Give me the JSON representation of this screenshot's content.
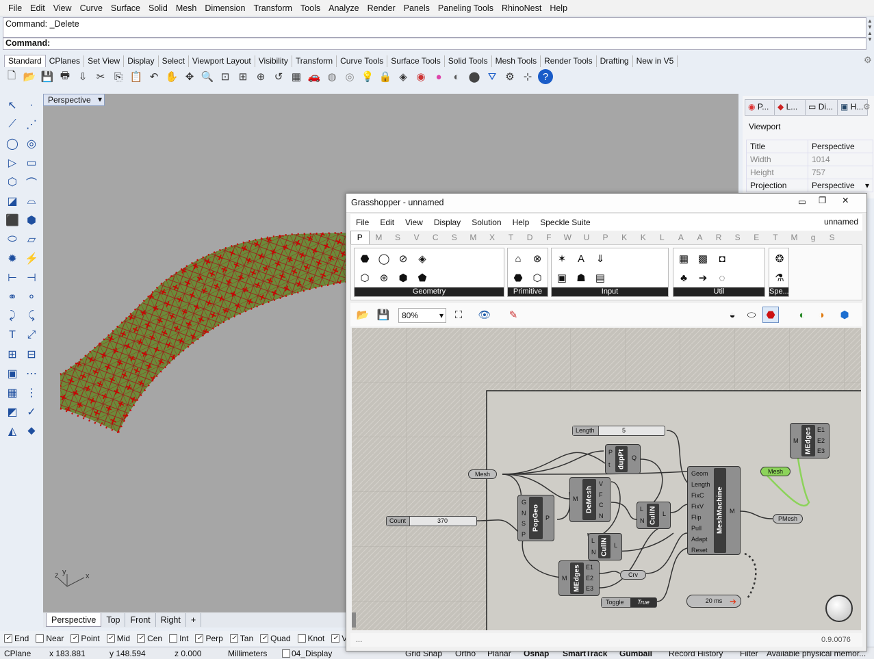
{
  "menubar": {
    "items": [
      "File",
      "Edit",
      "View",
      "Curve",
      "Surface",
      "Solid",
      "Mesh",
      "Dimension",
      "Transform",
      "Tools",
      "Analyze",
      "Render",
      "Panels",
      "Paneling Tools",
      "RhinoNest",
      "Help"
    ]
  },
  "command": {
    "history": "Command: _Delete",
    "prompt": "Command:"
  },
  "toolbar_tabs": [
    "Standard",
    "CPlanes",
    "Set View",
    "Display",
    "Select",
    "Viewport Layout",
    "Visibility",
    "Transform",
    "Curve Tools",
    "Surface Tools",
    "Solid Tools",
    "Mesh Tools",
    "Render Tools",
    "Drafting",
    "New in V5"
  ],
  "toolbar_icons": [
    "new-icon",
    "open-icon",
    "save-icon",
    "print-icon",
    "import-icon",
    "cut-icon",
    "copy-icon",
    "paste-icon",
    "undo-icon",
    "pan-icon",
    "rotate-view-icon",
    "zoom-icon",
    "zoom-window-icon",
    "zoom-extents-icon",
    "zoom-selected-icon",
    "undo-view-icon",
    "four-viewports-icon",
    "car-icon",
    "shade-icon",
    "render-preview-icon",
    "lightbulb-icon",
    "lock-icon",
    "layer-icon",
    "color-wheel-icon",
    "material-ball-icon",
    "environment-icon",
    "render-icon",
    "filter-icon",
    "options-gear-icon",
    "grid-snap-icon",
    "help-icon"
  ],
  "viewport": {
    "title": "Perspective",
    "axes": {
      "z": "z",
      "y": "y",
      "x": "x"
    }
  },
  "viewport_tabs": [
    "Perspective",
    "Top",
    "Front",
    "Right",
    "+"
  ],
  "osnaps": [
    {
      "label": "End",
      "checked": true
    },
    {
      "label": "Near",
      "checked": false
    },
    {
      "label": "Point",
      "checked": true
    },
    {
      "label": "Mid",
      "checked": true
    },
    {
      "label": "Cen",
      "checked": true
    },
    {
      "label": "Int",
      "checked": false
    },
    {
      "label": "Perp",
      "checked": true
    },
    {
      "label": "Tan",
      "checked": true
    },
    {
      "label": "Quad",
      "checked": true
    },
    {
      "label": "Knot",
      "checked": false
    },
    {
      "label": "Verte",
      "checked": true
    }
  ],
  "status": {
    "cplane": "CPlane",
    "x": "x 183.881",
    "y": "y 148.594",
    "z": "z 0.000",
    "units": "Millimeters",
    "layer": "04_Display",
    "buttons": [
      "Grid Snap",
      "Ortho",
      "Planar",
      "Osnap",
      "SmartTrack",
      "Gumball",
      "Record History",
      "Filter",
      "Available physical memor..."
    ]
  },
  "properties": {
    "tabs": [
      "P...",
      "L...",
      "Di...",
      "H..."
    ],
    "section": "Viewport",
    "rows": [
      {
        "key": "Title",
        "value": "Perspective"
      },
      {
        "key": "Width",
        "value": "1014"
      },
      {
        "key": "Height",
        "value": "757"
      },
      {
        "key": "Projection",
        "value": "Perspective"
      }
    ]
  },
  "grasshopper": {
    "title": "Grasshopper - unnamed",
    "doc_name": "unnamed",
    "menu": [
      "File",
      "Edit",
      "View",
      "Display",
      "Solution",
      "Help",
      "Speckle Suite"
    ],
    "tabs": [
      "P",
      "M",
      "S",
      "V",
      "C",
      "S",
      "M",
      "X",
      "T",
      "D",
      "F",
      "W",
      "U",
      "P",
      "K",
      "K",
      "L",
      "A",
      "A",
      "R",
      "S",
      "E",
      "T",
      "M",
      "g",
      "S"
    ],
    "ribbon_groups": [
      "Geometry",
      "Primitive",
      "Input",
      "Util",
      "Spe..."
    ],
    "zoom": "80%",
    "version": "0.9.0076",
    "nodes": {
      "length_label": "Length",
      "length_value": "5",
      "count_label": "Count",
      "count_value": "370",
      "mesh_param": "Mesh",
      "duppt": {
        "name": "dupPt",
        "inputs": [
          "P",
          "t"
        ],
        "outputs": [
          "Q"
        ]
      },
      "demesh": {
        "name": "DeMesh",
        "inputs": [
          "M"
        ],
        "outputs": [
          "V",
          "F",
          "C",
          "N"
        ]
      },
      "popgeo": {
        "name": "PopGeo",
        "inputs": [
          "G",
          "N",
          "S",
          "P"
        ],
        "outputs": [
          "P"
        ]
      },
      "culln1": {
        "name": "CullN",
        "inputs": [
          "L",
          "N"
        ],
        "outputs": [
          "L"
        ]
      },
      "culln2": {
        "name": "CullN",
        "inputs": [
          "L",
          "N"
        ],
        "outputs": [
          "L"
        ]
      },
      "medges1": {
        "name": "MEdges",
        "inputs": [
          "M"
        ],
        "outputs": [
          "E1",
          "E2",
          "E3"
        ]
      },
      "medges2": {
        "name": "MEdges",
        "inputs": [
          "M"
        ],
        "outputs": [
          "E1",
          "E2",
          "E3"
        ]
      },
      "crv": "Crv",
      "meshmachine": {
        "name": "MeshMachine",
        "inputs": [
          "Geom",
          "Length",
          "FixC",
          "FixV",
          "Flip",
          "Pull",
          "Adapt",
          "Reset"
        ],
        "outputs": [
          "M"
        ]
      },
      "mesh_out": "Mesh",
      "pmesh": "PMesh",
      "toggle_label": "Toggle",
      "toggle_value": "True",
      "timer": "20 ms"
    }
  }
}
